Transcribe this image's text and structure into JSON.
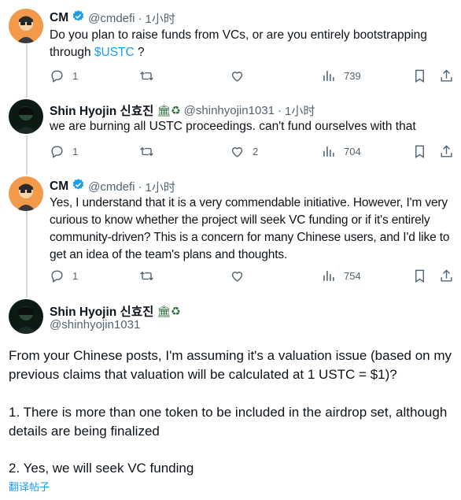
{
  "tweets": [
    {
      "name": "CM",
      "handle": "@cmdefi",
      "dot": "·",
      "time": "1小时",
      "text_before": "Do you plan to raise funds from VCs, or are you entirely bootstrapping through ",
      "cashtag": "$USTC",
      "text_after": " ?",
      "replies": "1",
      "retweets": "",
      "likes": "",
      "views": "739"
    },
    {
      "name": "Shin Hyojin 신효진",
      "badges": "🏛♻",
      "handle": "@shinhyojin1031",
      "dot": "·",
      "time": "1小时",
      "text": "we are burning all USTC proceedings. can't fund ourselves with that",
      "replies": "1",
      "retweets": "",
      "likes": "2",
      "views": "704"
    },
    {
      "name": "CM",
      "handle": "@cmdefi",
      "dot": "·",
      "time": "1小时",
      "text": "Yes, I understand that it is a very commendable initiative. However, I'm very curious to know whether the project will seek VC funding or if it's entirely community-driven? This is a concern for many Chinese users, and I'd like to get an idea of the team's plans and thoughts.",
      "replies": "1",
      "retweets": "",
      "likes": "",
      "views": "754"
    }
  ],
  "main_tweet": {
    "name": "Shin Hyojin 신효진",
    "badges": "🏛♻",
    "handle": "@shinhyojin1031",
    "para1": "From your Chinese posts, I'm assuming it's a valuation issue (based on my previous claims that valuation will be calculated at 1 USTC = $1)?",
    "para2": "1. There is more than one token to be included in the airdrop set, although details are being finalized",
    "para3": "2. Yes, we will seek VC funding",
    "translate": "翻译帖子"
  },
  "colors": {
    "accent": "#1d9bf0",
    "muted": "#536471",
    "text": "#0f1419",
    "thread": "#cfd9de"
  }
}
